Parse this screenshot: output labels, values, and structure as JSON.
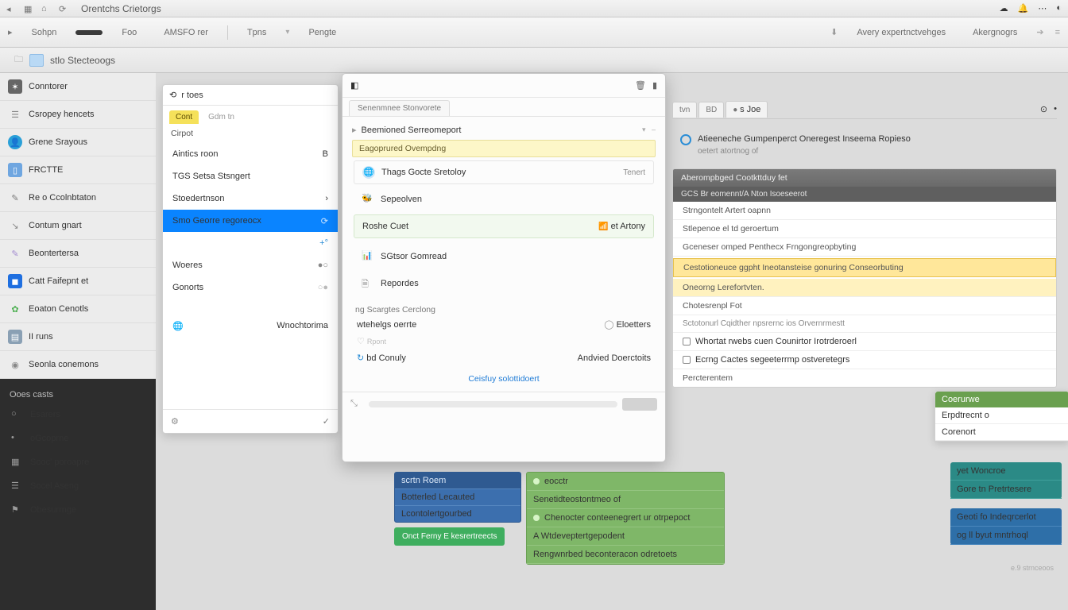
{
  "topstrip": {
    "title": "Orentchs Crietorgs"
  },
  "tabbar": {
    "tabs": [
      "Sohpn",
      "Foo",
      "AMSFO rer",
      "Tpns",
      "Pengte"
    ],
    "right": [
      "Avery expertnctvehges",
      "Akergnogrs"
    ]
  },
  "subbar": {
    "title": "stlo Stecteoogs"
  },
  "sidebar_a": [
    {
      "label": "Conntorer",
      "icon": "gear-icon",
      "ic_bg": "#666",
      "ic_fg": "#fff"
    },
    {
      "label": "Csropey hencets",
      "icon": "layers-icon",
      "ic_bg": "#e8e8e8",
      "ic_fg": "#888"
    },
    {
      "label": "Grene Srayous",
      "icon": "user-icon",
      "ic_bg": "#2aa0d8",
      "ic_fg": "#fff"
    },
    {
      "label": "FRCTTE",
      "icon": "doc-icon",
      "ic_bg": "#6fa6e0",
      "ic_fg": "#fff"
    },
    {
      "label": "Re o Ccolnbtaton",
      "icon": "pencil-icon",
      "ic_bg": "#e8e8e8",
      "ic_fg": "#7a7a7a"
    },
    {
      "label": "Contum gnart",
      "icon": "arrow-icon",
      "ic_bg": "#e8e8e8",
      "ic_fg": "#888"
    },
    {
      "label": "Beontertersa",
      "icon": "note-icon",
      "ic_bg": "#e8e8e8",
      "ic_fg": "#a28bd0"
    },
    {
      "label": "Catt Faifepnt et",
      "icon": "square-icon",
      "ic_bg": "#1f6fe0",
      "ic_fg": "#fff"
    },
    {
      "label": "Eoaton Cenotls",
      "icon": "leaf-icon",
      "ic_bg": "#e8e8e8",
      "ic_fg": "#4caf50"
    },
    {
      "label": "II runs",
      "icon": "bars-icon",
      "ic_bg": "#8aa0b4",
      "ic_fg": "#fff"
    },
    {
      "label": "Seonla conemons",
      "icon": "globe-icon",
      "ic_bg": "#e8e8e8",
      "ic_fg": "#888"
    }
  ],
  "sidebar_b": {
    "header": "Ooes casts",
    "items": [
      {
        "label": "Esarers",
        "icon": "dot-icon"
      },
      {
        "label": "oGcoprne",
        "icon": "dot-icon"
      },
      {
        "label": "Sooc' poroapre",
        "icon": "grid-icon"
      },
      {
        "label": "Socel Aseng",
        "icon": "list-icon"
      },
      {
        "label": "Obesurrnge",
        "icon": "tag-icon"
      }
    ]
  },
  "panelA": {
    "head": "r toes",
    "tab_on": "Cont",
    "tab_off": "Gdm tn",
    "section": "Cirpot",
    "items": [
      {
        "label": "Aintics roon",
        "right": "B"
      },
      {
        "label": "TGS Setsa Stsngert"
      },
      {
        "label": "Stoedertnson",
        "right": "›"
      },
      {
        "label": "Smo Georre regoreocx",
        "sel": true,
        "ricon": "refresh-icon"
      },
      {
        "label": "",
        "ricon": "plus-icon"
      },
      {
        "label": "Woeres",
        "ricon": "toggle-icon"
      },
      {
        "label": "Gonorts",
        "ricon": "toggle-off-icon"
      },
      {
        "label": "Wnochtorima"
      }
    ]
  },
  "dialog": {
    "tab": "Senenmnee Stonvorete",
    "title": "Beemioned Serreomeport",
    "highlight": "Eagoprured Ovempdng",
    "opts": [
      {
        "icon": "globe-blue-icon",
        "label": "Thags Gocte Sretoloy",
        "tag": "Tenert"
      },
      {
        "icon": "bee-icon",
        "label": "Sepeolven"
      },
      {
        "label": "Roshe Cuet",
        "tag": "et Artony",
        "green": true,
        "icon": "signal-icon"
      }
    ],
    "blocks": [
      {
        "icon": "chart-icon",
        "label": "SGtsor Gomread"
      },
      {
        "icon": "doc2-icon",
        "label": "Repordes"
      }
    ],
    "label2": "ng Scargtes Cerclong",
    "rows": [
      {
        "l": "wtehelgs oerrte",
        "r": "Eloetters",
        "ricon": "circle-icon"
      },
      {
        "l": "",
        "r": "",
        "icon": "heart-icon",
        "sub": "Rpont"
      },
      {
        "l": "bd Conuly",
        "r": "Andvied Doerctoits",
        "icon": "sync-icon"
      }
    ],
    "link": "Ceisfuy solottidoert"
  },
  "right": {
    "tabs": [
      "tvn",
      "BD",
      "s Joe"
    ],
    "alert": {
      "title": "Atieeneche Gumpenperct Oneregest Inseema Ropieso",
      "sub": "oetert atortnog of"
    },
    "card": {
      "hd": "Aberompbged Cootkttduy fet",
      "hd2": "GCS Br eomennt/A Nton Isoeseerot",
      "lines": [
        "Strngontelt Artert oapnn",
        "Stlepenoe el td geroertum",
        "Gceneser omped Penthecx Frngongreopbyting"
      ],
      "warn": "Cestotioneuce ggpht Ineotansteise gonuring Conseorbuting",
      "warn2": "Oneorng Lerefortvten.",
      "after": "Chotesrenpl Fot",
      "sect": "Sctotonurl Cqidther npsrernc ios Orvernrmestt",
      "checks": [
        "Whortat rwebs cuen Counirtor Irotrderoerl",
        "Ecrng Cactes segeeterrmp ostveretegrs"
      ],
      "afterck": "Percterentem"
    }
  },
  "bluecard": {
    "hd": "scrtn    Roem",
    "lines": [
      "Botterled Lecauted",
      "Lcontolertgourbed"
    ]
  },
  "greenbtn": "Onct Ferny E kesrertreects",
  "greencard": {
    "lines": [
      "eocctr",
      "Senetidteostontmeo of",
      "Chenocter conteenegrert ur otrpepoct",
      "A Wtdeveptertgepodent",
      "Rengwnrbed beconteracon odretoets"
    ]
  },
  "mini": {
    "hd": "Coerurwe",
    "items": [
      "Erpdtrecnt o",
      "Corenort"
    ]
  },
  "tealcard": {
    "lines": [
      "yet  Woncroe",
      "Gore tn Pretrtesere"
    ]
  },
  "bluecard2": {
    "lines": [
      "Geoti fo Indeqrcerlot",
      "og ll byut mntrhoql"
    ]
  },
  "faint": "e.9 strnceoos"
}
